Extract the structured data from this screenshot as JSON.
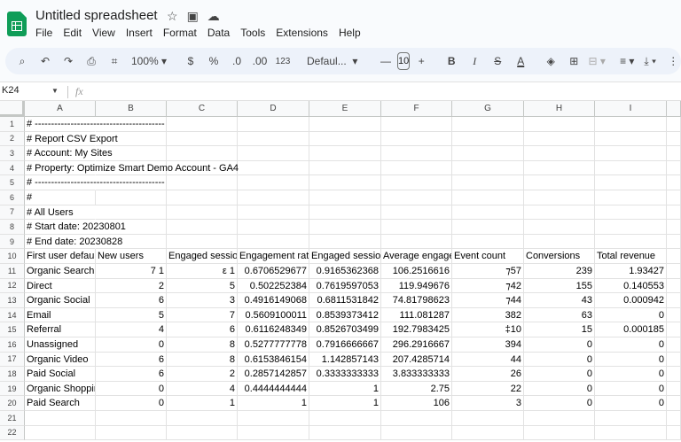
{
  "doc": {
    "title": "Untitled spreadsheet"
  },
  "menu": [
    "File",
    "Edit",
    "View",
    "Insert",
    "Format",
    "Data",
    "Tools",
    "Extensions",
    "Help"
  ],
  "toolbar": {
    "zoom": "100%",
    "currency": "$",
    "percent": "%",
    "dec_decrease": ".0",
    "dec_increase": ".00",
    "number_format": "123",
    "font": "Defaul...",
    "font_size": "10",
    "bold": "B",
    "italic": "I",
    "strike": "S",
    "text_color": "A"
  },
  "formula_bar": {
    "cell_ref": "K24",
    "fx": "fx",
    "value": ""
  },
  "columns": [
    "A",
    "B",
    "C",
    "D",
    "E",
    "F",
    "G",
    "H",
    "I"
  ],
  "rows": [
    {
      "n": "1",
      "cells": [
        {
          "c": 0,
          "v": "# ----------------------------------------",
          "o": true
        }
      ]
    },
    {
      "n": "2",
      "cells": [
        {
          "c": 0,
          "v": "# Report CSV Export",
          "o": true
        }
      ]
    },
    {
      "n": "3",
      "cells": [
        {
          "c": 0,
          "v": "# Account: My Sites",
          "o": true
        }
      ]
    },
    {
      "n": "4",
      "cells": [
        {
          "c": 0,
          "v": "# Property: Optimize Smart Demo Account - GA4",
          "o": true
        }
      ]
    },
    {
      "n": "5",
      "cells": [
        {
          "c": 0,
          "v": "# ----------------------------------------",
          "o": true
        }
      ]
    },
    {
      "n": "6",
      "cells": [
        {
          "c": 0,
          "v": "#"
        }
      ]
    },
    {
      "n": "7",
      "cells": [
        {
          "c": 0,
          "v": "# All Users",
          "o": true
        }
      ]
    },
    {
      "n": "8",
      "cells": [
        {
          "c": 0,
          "v": "# Start date: 20230801",
          "o": true
        }
      ]
    },
    {
      "n": "9",
      "cells": [
        {
          "c": 0,
          "v": "# End date: 20230828",
          "o": true
        }
      ]
    },
    {
      "n": "10",
      "cells": [
        {
          "c": 0,
          "v": "First user default"
        },
        {
          "c": 1,
          "v": "New users"
        },
        {
          "c": 2,
          "v": "Engaged sessions"
        },
        {
          "c": 3,
          "v": "Engagement rate"
        },
        {
          "c": 4,
          "v": "Engaged sessions"
        },
        {
          "c": 5,
          "v": "Average engagement"
        },
        {
          "c": 6,
          "v": "Event count"
        },
        {
          "c": 7,
          "v": "Conversions"
        },
        {
          "c": 8,
          "v": "Total revenue"
        }
      ]
    },
    {
      "n": "11",
      "cells": [
        {
          "c": 0,
          "v": "Organic Search"
        },
        {
          "c": 1,
          "v": "7   1",
          "num": true
        },
        {
          "c": 2,
          "v": "ε   1",
          "num": true
        },
        {
          "c": 3,
          "v": "0.6706529677",
          "num": true
        },
        {
          "c": 4,
          "v": "0.9165362368",
          "num": true
        },
        {
          "c": 5,
          "v": "106.2516616",
          "num": true
        },
        {
          "c": 6,
          "v": "⁊57",
          "num": true
        },
        {
          "c": 7,
          "v": "239",
          "num": true
        },
        {
          "c": 8,
          "v": "1.93427",
          "num": true
        }
      ]
    },
    {
      "n": "12",
      "cells": [
        {
          "c": 0,
          "v": "Direct"
        },
        {
          "c": 1,
          "v": "2",
          "num": true
        },
        {
          "c": 2,
          "v": "5",
          "num": true
        },
        {
          "c": 3,
          "v": "0.502252384",
          "num": true
        },
        {
          "c": 4,
          "v": "0.7619597053",
          "num": true
        },
        {
          "c": 5,
          "v": "119.949676",
          "num": true
        },
        {
          "c": 6,
          "v": "⁊42",
          "num": true
        },
        {
          "c": 7,
          "v": "155",
          "num": true
        },
        {
          "c": 8,
          "v": "0.140553",
          "num": true
        }
      ]
    },
    {
      "n": "13",
      "cells": [
        {
          "c": 0,
          "v": "Organic Social"
        },
        {
          "c": 1,
          "v": "6",
          "num": true
        },
        {
          "c": 2,
          "v": "3",
          "num": true
        },
        {
          "c": 3,
          "v": "0.4916149068",
          "num": true
        },
        {
          "c": 4,
          "v": "0.6811531842",
          "num": true
        },
        {
          "c": 5,
          "v": "74.81798623",
          "num": true
        },
        {
          "c": 6,
          "v": "⁊44",
          "num": true
        },
        {
          "c": 7,
          "v": "43",
          "num": true
        },
        {
          "c": 8,
          "v": "0.000942",
          "num": true
        }
      ]
    },
    {
      "n": "14",
      "cells": [
        {
          "c": 0,
          "v": "Email"
        },
        {
          "c": 1,
          "v": "5",
          "num": true
        },
        {
          "c": 2,
          "v": "7",
          "num": true
        },
        {
          "c": 3,
          "v": "0.5609100011",
          "num": true
        },
        {
          "c": 4,
          "v": "0.8539373412",
          "num": true
        },
        {
          "c": 5,
          "v": "111.081287",
          "num": true
        },
        {
          "c": 6,
          "v": "382",
          "num": true
        },
        {
          "c": 7,
          "v": "63",
          "num": true
        },
        {
          "c": 8,
          "v": "0",
          "num": true
        }
      ]
    },
    {
      "n": "15",
      "cells": [
        {
          "c": 0,
          "v": "Referral"
        },
        {
          "c": 1,
          "v": "4",
          "num": true
        },
        {
          "c": 2,
          "v": "6",
          "num": true
        },
        {
          "c": 3,
          "v": "0.6116248349",
          "num": true
        },
        {
          "c": 4,
          "v": "0.8526703499",
          "num": true
        },
        {
          "c": 5,
          "v": "192.7983425",
          "num": true
        },
        {
          "c": 6,
          "v": "‡10",
          "num": true
        },
        {
          "c": 7,
          "v": "15",
          "num": true
        },
        {
          "c": 8,
          "v": "0.000185",
          "num": true
        }
      ]
    },
    {
      "n": "16",
      "cells": [
        {
          "c": 0,
          "v": "Unassigned"
        },
        {
          "c": 1,
          "v": "0",
          "num": true
        },
        {
          "c": 2,
          "v": "8",
          "num": true
        },
        {
          "c": 3,
          "v": "0.5277777778",
          "num": true
        },
        {
          "c": 4,
          "v": "0.7916666667",
          "num": true
        },
        {
          "c": 5,
          "v": "296.2916667",
          "num": true
        },
        {
          "c": 6,
          "v": "394",
          "num": true
        },
        {
          "c": 7,
          "v": "0",
          "num": true
        },
        {
          "c": 8,
          "v": "0",
          "num": true
        }
      ]
    },
    {
      "n": "17",
      "cells": [
        {
          "c": 0,
          "v": "Organic Video"
        },
        {
          "c": 1,
          "v": "6",
          "num": true
        },
        {
          "c": 2,
          "v": "8",
          "num": true
        },
        {
          "c": 3,
          "v": "0.6153846154",
          "num": true
        },
        {
          "c": 4,
          "v": "1.142857143",
          "num": true
        },
        {
          "c": 5,
          "v": "207.4285714",
          "num": true
        },
        {
          "c": 6,
          "v": "44",
          "num": true
        },
        {
          "c": 7,
          "v": "0",
          "num": true
        },
        {
          "c": 8,
          "v": "0",
          "num": true
        }
      ]
    },
    {
      "n": "18",
      "cells": [
        {
          "c": 0,
          "v": "Paid Social"
        },
        {
          "c": 1,
          "v": "6",
          "num": true
        },
        {
          "c": 2,
          "v": "2",
          "num": true
        },
        {
          "c": 3,
          "v": "0.2857142857",
          "num": true
        },
        {
          "c": 4,
          "v": "0.3333333333",
          "num": true
        },
        {
          "c": 5,
          "v": "3.833333333",
          "num": true
        },
        {
          "c": 6,
          "v": "26",
          "num": true
        },
        {
          "c": 7,
          "v": "0",
          "num": true
        },
        {
          "c": 8,
          "v": "0",
          "num": true
        }
      ]
    },
    {
      "n": "19",
      "cells": [
        {
          "c": 0,
          "v": "Organic Shopping"
        },
        {
          "c": 1,
          "v": "0",
          "num": true
        },
        {
          "c": 2,
          "v": "4",
          "num": true
        },
        {
          "c": 3,
          "v": "0.4444444444",
          "num": true
        },
        {
          "c": 4,
          "v": "1",
          "num": true
        },
        {
          "c": 5,
          "v": "2.75",
          "num": true
        },
        {
          "c": 6,
          "v": "22",
          "num": true
        },
        {
          "c": 7,
          "v": "0",
          "num": true
        },
        {
          "c": 8,
          "v": "0",
          "num": true
        }
      ]
    },
    {
      "n": "20",
      "cells": [
        {
          "c": 0,
          "v": "Paid Search"
        },
        {
          "c": 1,
          "v": "0",
          "num": true
        },
        {
          "c": 2,
          "v": "1",
          "num": true
        },
        {
          "c": 3,
          "v": "1",
          "num": true
        },
        {
          "c": 4,
          "v": "1",
          "num": true
        },
        {
          "c": 5,
          "v": "106",
          "num": true
        },
        {
          "c": 6,
          "v": "3",
          "num": true
        },
        {
          "c": 7,
          "v": "0",
          "num": true
        },
        {
          "c": 8,
          "v": "0",
          "num": true
        }
      ]
    },
    {
      "n": "21",
      "cells": []
    },
    {
      "n": "22",
      "cells": []
    }
  ]
}
